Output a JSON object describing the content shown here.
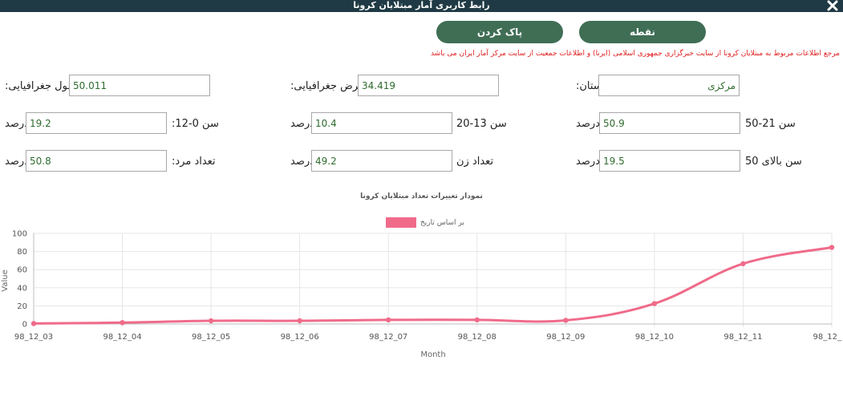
{
  "window": {
    "title": "رابط کاربری آمار مبتلایان کرونا"
  },
  "toolbar": {
    "point_label": "نقطه",
    "clear_label": "پاک کردن"
  },
  "source_note": "مرجع اطلاعات مربوط به مبتلایان کرونا از سایت خبرگزاری جمهوری اسلامی (ایرنا) و اطلاعات جمعیت از سایت مرکز آمار ایران می باشد",
  "fields": {
    "longitude": {
      "label": "طول جغرافیایی:",
      "value": "50.011"
    },
    "latitude": {
      "label": "عرض جغرافیایی:",
      "value": "34.419"
    },
    "province": {
      "label": "استان:",
      "value": "مرکزی"
    },
    "age_0_12": {
      "label": "سن 0-12:",
      "value": "19.2",
      "unit": "درصد"
    },
    "age_13_20": {
      "label": "سن 13-20",
      "value": "10.4",
      "unit": "درصد"
    },
    "age_21_50": {
      "label": "سن 21-50",
      "value": "50.9",
      "unit": "درصد"
    },
    "men": {
      "label": "تعداد مرد:",
      "value": "50.8",
      "unit": "درصد"
    },
    "women": {
      "label": "تعداد زن",
      "value": "49.2",
      "unit": "درصد"
    },
    "age_50_plus": {
      "label": "سن بالای 50",
      "value": "19.5",
      "unit": "درصد"
    }
  },
  "colors": {
    "titlebar": "#1f3a44",
    "button": "#3f6e55",
    "series": "#f06b8a",
    "note": "#e02020"
  },
  "chart_data": {
    "type": "line",
    "title": "نمودار تغییرات تعداد مبتلایان کرونا",
    "xlabel": "Month",
    "ylabel": "Value",
    "ylim": [
      0,
      100
    ],
    "yticks": [
      0,
      20,
      40,
      60,
      80,
      100
    ],
    "grid": true,
    "legend_position": "top-center",
    "x": [
      "98_12_03",
      "98_12_04",
      "98_12_05",
      "98_12_06",
      "98_12_07",
      "98_12_08",
      "98_12_09",
      "98_12_10",
      "98_12_11",
      "98_12_"
    ],
    "series": [
      {
        "name": "بر اساس تاریخ",
        "values": [
          0.5,
          1.5,
          3.5,
          3.5,
          4.5,
          4.5,
          4,
          22.5,
          66.5,
          84.5
        ]
      }
    ]
  }
}
